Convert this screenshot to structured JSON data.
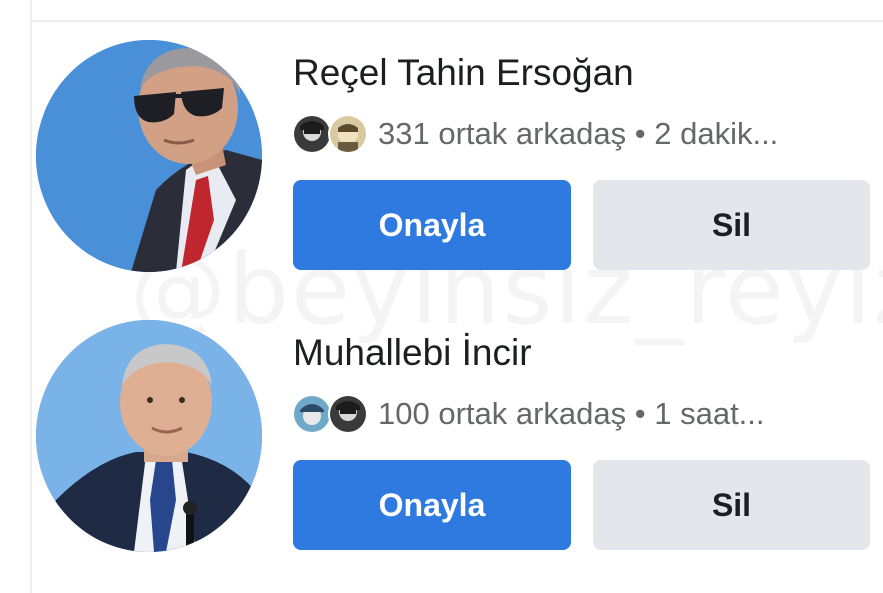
{
  "watermark": "@beyinsiz_reyiz",
  "requests": [
    {
      "name": "Reçel Tahin Ersoğan",
      "mutual_friends": "331 ortak arkadaş • 2 dakik...",
      "confirm_label": "Onayla",
      "delete_label": "Sil"
    },
    {
      "name": "Muhallebi İncir",
      "mutual_friends": "100 ortak arkadaş • 1 saat...",
      "confirm_label": "Onayla",
      "delete_label": "Sil"
    }
  ],
  "colors": {
    "confirm_button": "#2f7ae0",
    "delete_button": "#e4e6eb",
    "avatar_background": "#4a90d9",
    "secondary_text": "#65676b"
  }
}
